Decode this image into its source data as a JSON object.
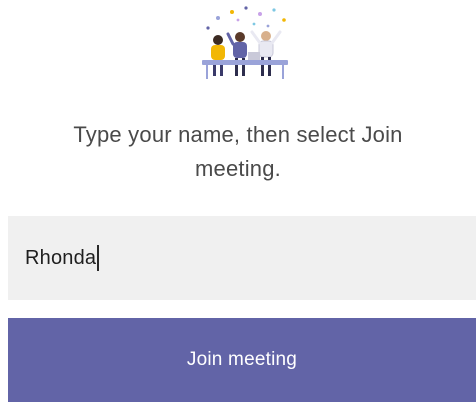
{
  "illustration": {
    "icon": "meeting-people-illustration"
  },
  "prompt": {
    "line1": "Type your name, then select Join",
    "line2": "meeting."
  },
  "name_input": {
    "value": "Rhonda"
  },
  "join_button": {
    "label": "Join meeting"
  },
  "colors": {
    "accent": "#6264a7",
    "input_background": "#f0f0f0",
    "text": "#4a4a4a"
  }
}
